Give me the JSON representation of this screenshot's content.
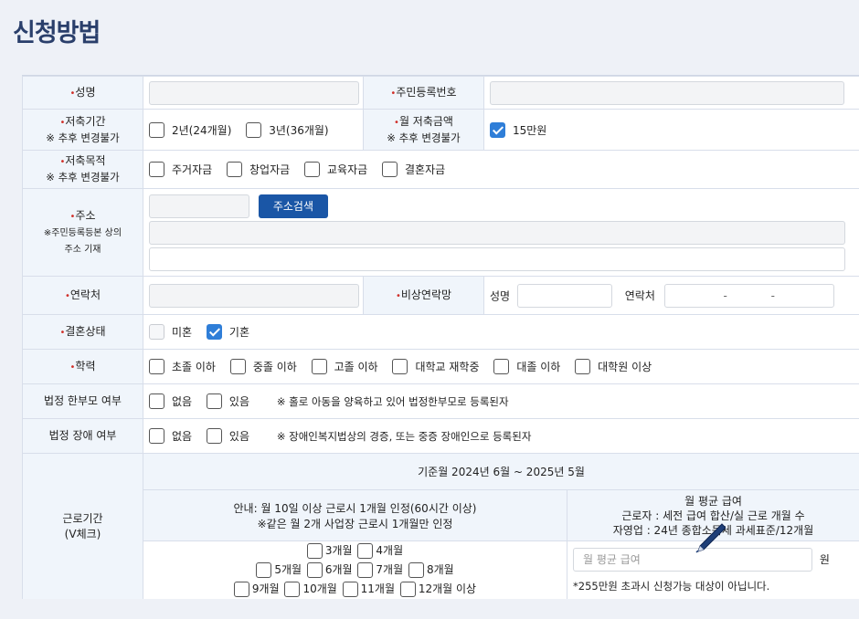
{
  "page": {
    "title": "신청방법"
  },
  "form": {
    "name": {
      "label": "성명",
      "value": ""
    },
    "rrn": {
      "label": "주민등록번호",
      "value": ""
    },
    "period": {
      "label": "저축기간",
      "note": "※ 추후 변경불가",
      "options": [
        {
          "label": "2년(24개월)",
          "checked": false
        },
        {
          "label": "3년(36개월)",
          "checked": false
        }
      ]
    },
    "monthly": {
      "label": "월 저축금액",
      "note": "※ 추후 변경불가",
      "options": [
        {
          "label": "15만원",
          "checked": true
        }
      ]
    },
    "purpose": {
      "label": "저축목적",
      "note": "※ 추후 변경불가",
      "options": [
        {
          "label": "주거자금",
          "checked": false
        },
        {
          "label": "창업자금",
          "checked": false
        },
        {
          "label": "교육자금",
          "checked": false
        },
        {
          "label": "결혼자금",
          "checked": false
        }
      ]
    },
    "address": {
      "label": "주소",
      "note1": "※주민등록등본 상의",
      "note2": "주소 기재",
      "search_button": "주소검색"
    },
    "contact": {
      "label": "연락처"
    },
    "emergency": {
      "label": "비상연락망",
      "name_label": "성명",
      "phone_label": "연락처",
      "dash1": "-",
      "dash2": "-"
    },
    "marital": {
      "label": "결혼상태",
      "options": [
        {
          "label": "미혼",
          "checked": false,
          "disabled": true
        },
        {
          "label": "기혼",
          "checked": true
        }
      ]
    },
    "education": {
      "label": "학력",
      "options": [
        {
          "label": "초졸 이하",
          "checked": false
        },
        {
          "label": "중졸 이하",
          "checked": false
        },
        {
          "label": "고졸 이하",
          "checked": false
        },
        {
          "label": "대학교 재학중",
          "checked": false
        },
        {
          "label": "대졸 이하",
          "checked": false
        },
        {
          "label": "대학원 이상",
          "checked": false
        }
      ]
    },
    "single_parent": {
      "label": "법정 한부모 여부",
      "options": [
        {
          "label": "없음",
          "checked": false
        },
        {
          "label": "있음",
          "checked": false
        }
      ],
      "note": "※ 홀로 아동을 양육하고 있어 법정한부모로 등록된자"
    },
    "disability": {
      "label": "법정 장애 여부",
      "options": [
        {
          "label": "없음",
          "checked": false
        },
        {
          "label": "있음",
          "checked": false
        }
      ],
      "note": "※ 장애인복지법상의 경증, 또는 중증 장애인으로 등록된자"
    },
    "work": {
      "label": "근로기간",
      "label2": "(V체크)",
      "period_header": "기준월 2024년 6월 ~ 2025년 5월",
      "guide1": "안내: 월 10일 이상 근로시 1개월 인정(60시간 이상)",
      "guide2": "※같은 월 2개 사업장 근로시 1개월만 인정",
      "salary_title": "월 평균 급여",
      "salary_worker": "근로자 : 세전 급여 합산/실 근로 개월 수",
      "salary_self": "자영업 : 24년 종합소득세 과세표준/12개월",
      "salary_placeholder": "월 평균 급여",
      "salary_unit": "원",
      "salary_note": "*255만원 초과시 신청가능 대상이 아닙니다.",
      "months_row1": [
        "3개월",
        "4개월"
      ],
      "months_row2": [
        "5개월",
        "6개월",
        "7개월",
        "8개월"
      ],
      "months_row3": [
        "9개월",
        "10개월",
        "11개월",
        "12개월 이상"
      ]
    }
  }
}
